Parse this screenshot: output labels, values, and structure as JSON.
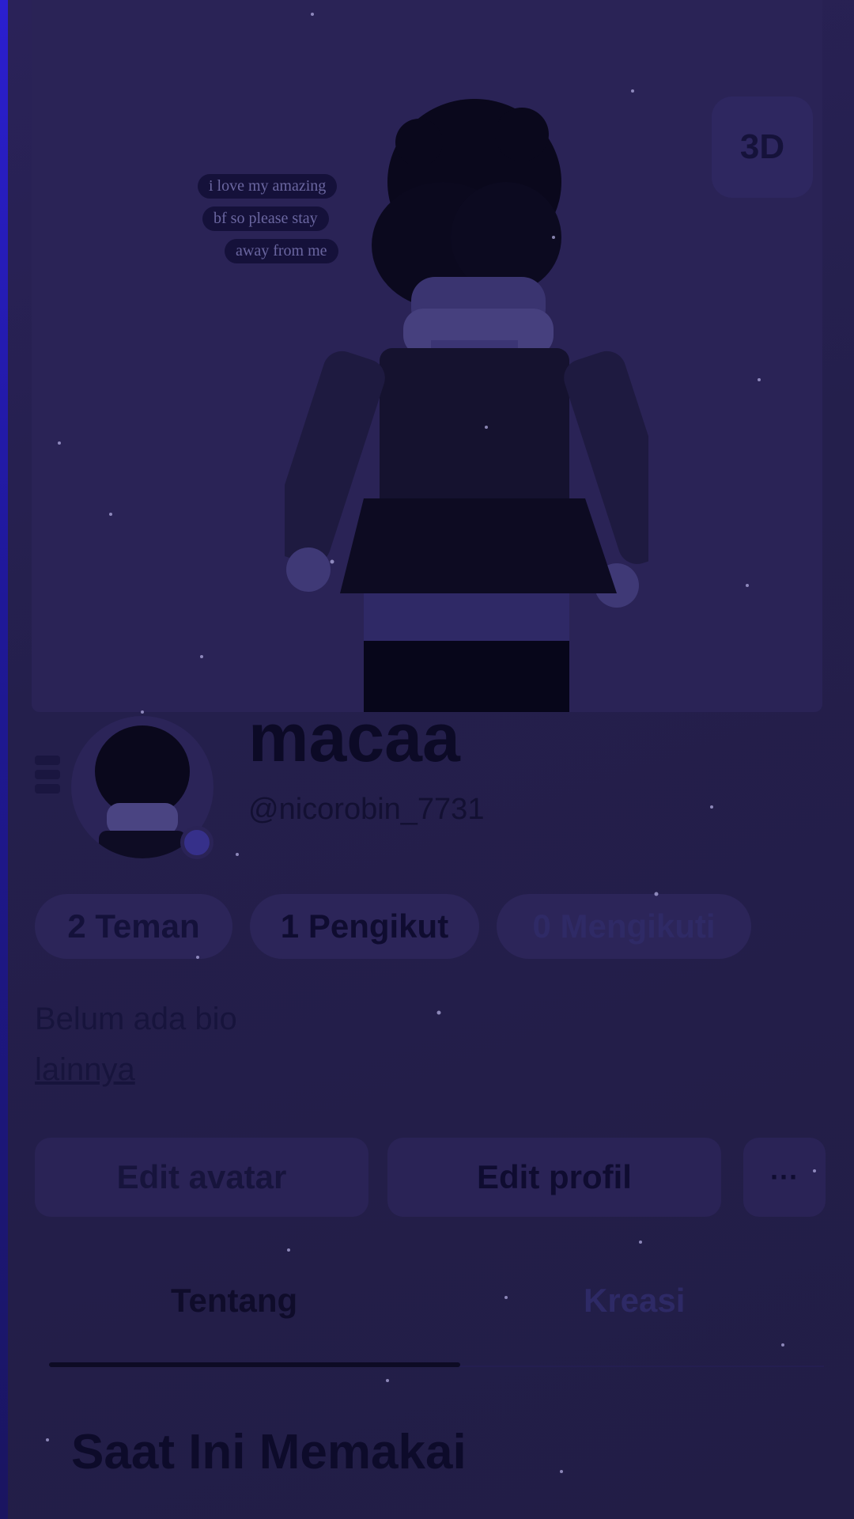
{
  "viewer": {
    "toggle_3d_label": "3D",
    "chat_bubbles": [
      "i love my amazing",
      "bf so please stay",
      "away from me"
    ]
  },
  "profile": {
    "display_name": "macaa",
    "username": "@nicorobin_7731",
    "stats": {
      "friends": "2 Teman",
      "followers": "1 Pengikut",
      "following": "0 Mengikuti"
    },
    "bio": "Belum ada bio",
    "more_link": "lainnya"
  },
  "actions": {
    "edit_avatar": "Edit avatar",
    "edit_profile": "Edit profil",
    "more": "···"
  },
  "tabs": [
    {
      "label": "Tentang",
      "active": true
    },
    {
      "label": "Kreasi",
      "active": false
    }
  ],
  "section": {
    "title": "Saat Ini Memakai"
  },
  "colors": {
    "background": "#221d4a",
    "overlay_tint": "#2b1fd0",
    "text_dark": "#0c0a26"
  }
}
